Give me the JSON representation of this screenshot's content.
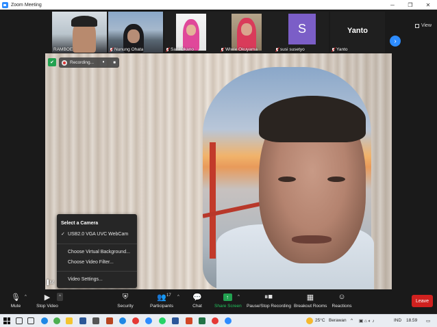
{
  "window": {
    "title": "Zoom Meeting"
  },
  "thumbnails": [
    {
      "name": "RAMBOE",
      "muted": false
    },
    {
      "name": "Nunung Ohata",
      "muted": true
    },
    {
      "name": "Sarii Okano",
      "muted": true
    },
    {
      "name": "Wiwie Okuyama",
      "muted": true
    },
    {
      "name": "susi susetyo",
      "muted": true,
      "avatar_letter": "S"
    },
    {
      "name": "Yanto",
      "muted": true,
      "display_text": "Yanto"
    }
  ],
  "view_button": {
    "label": "View"
  },
  "recording": {
    "label": "Recording...",
    "pause_glyph": "⏸",
    "stop_glyph": "■"
  },
  "main_video": {
    "name": "M"
  },
  "camera_menu": {
    "heading": "Select a Camera",
    "camera": "USB2.0 VGA UVC WebCam",
    "check_glyph": "✓",
    "options": [
      "Choose Virtual Background...",
      "Choose Video Filter..."
    ],
    "settings": "Video Settings..."
  },
  "toolbar": {
    "mute": "Mute",
    "stop_video": "Stop Video",
    "security": "Security",
    "participants": "Participants",
    "participants_count": "17",
    "chat": "Chat",
    "share_screen": "Share Screen",
    "pause_recording": "Pause/Stop Recording",
    "breakout_rooms": "Breakout Rooms",
    "reactions": "Reactions",
    "leave": "Leave",
    "caret": "^"
  },
  "taskbar": {
    "temperature": "25°C",
    "weather": "Berawan",
    "language": "IND",
    "time": "18.59"
  },
  "colors": {
    "accent": "#2d8cff",
    "leave": "#d0211f",
    "share": "#22a150",
    "recording": "#d33333"
  }
}
